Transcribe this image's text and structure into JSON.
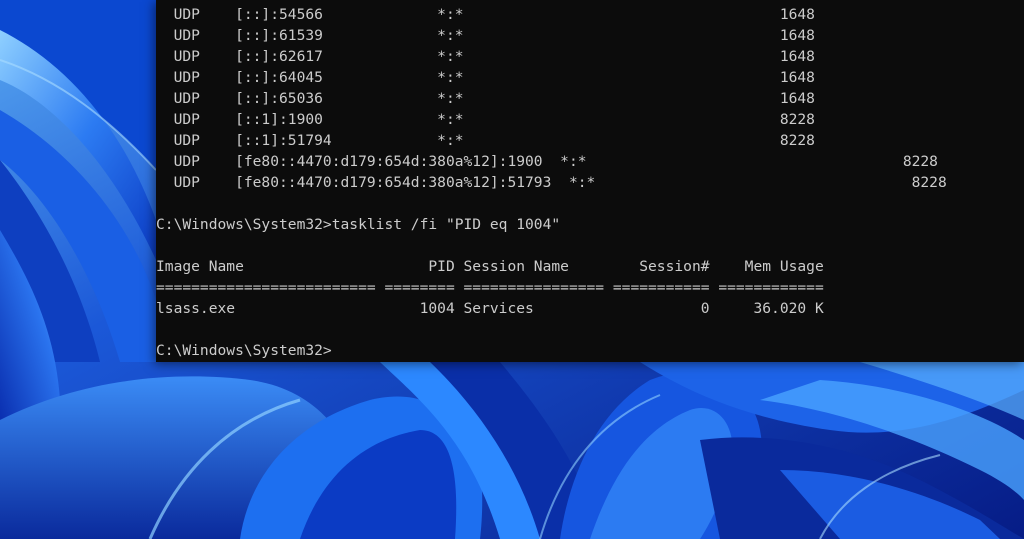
{
  "terminal": {
    "lines": [
      "  UDP    [::]:54566             *:*                                    1648",
      "  UDP    [::]:61539             *:*                                    1648",
      "  UDP    [::]:62617             *:*                                    1648",
      "  UDP    [::]:64045             *:*                                    1648",
      "  UDP    [::]:65036             *:*                                    1648",
      "  UDP    [::1]:1900             *:*                                    8228",
      "  UDP    [::1]:51794            *:*                                    8228",
      "  UDP    [fe80::4470:d179:654d:380a%12]:1900  *:*                                    8228",
      "  UDP    [fe80::4470:d179:654d:380a%12]:51793  *:*                                    8228",
      "",
      "C:\\Windows\\System32>tasklist /fi \"PID eq 1004\"",
      "",
      "Image Name                     PID Session Name        Session#    Mem Usage",
      "========================= ======== ================ =========== ============",
      "lsass.exe                     1004 Services                   0     36.020 K",
      "",
      "C:\\Windows\\System32>"
    ]
  },
  "colors": {
    "terminal_bg": "#0c0c0c",
    "terminal_fg": "#cccccc",
    "wallpaper_base": "#0a2a9c"
  }
}
